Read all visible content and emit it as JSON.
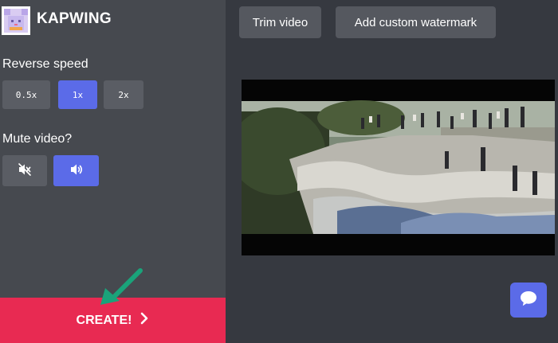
{
  "app": {
    "brand": "KAPWING",
    "logo_icon": "kapwing-cat-logo"
  },
  "sidebar": {
    "reverse_speed_label": "Reverse speed",
    "speeds": [
      {
        "label": "0.5x",
        "active": false
      },
      {
        "label": "1x",
        "active": true
      },
      {
        "label": "2x",
        "active": false
      }
    ],
    "mute_label": "Mute video?",
    "mute_options": [
      {
        "icon": "speaker-muted-icon",
        "active": false
      },
      {
        "icon": "speaker-on-icon",
        "active": true
      }
    ],
    "create_label": "CREATE!"
  },
  "toolbar": {
    "trim_label": "Trim video",
    "watermark_label": "Add custom watermark"
  },
  "colors": {
    "accent": "#5b6be8",
    "create": "#e82a52",
    "annotation_arrow": "#1aa37a"
  },
  "chat_icon": "chat-bubble-icon"
}
